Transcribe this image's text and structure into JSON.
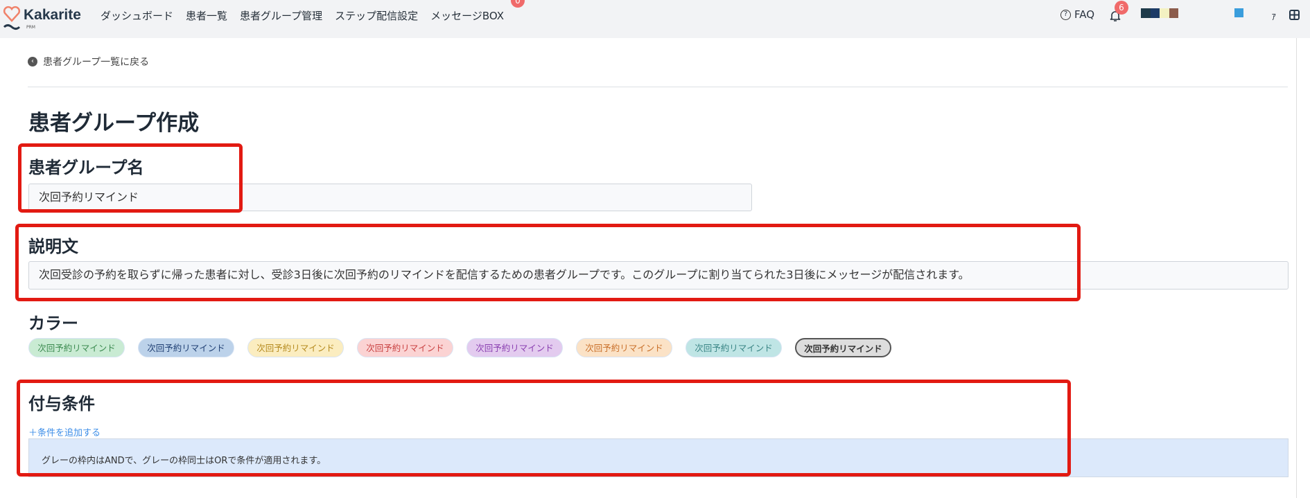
{
  "header": {
    "logo": "Kakarite",
    "logo_sub": "PRM",
    "nav": [
      "ダッシュボード",
      "患者一覧",
      "患者グループ管理",
      "ステップ配信設定",
      "メッセージBOX"
    ],
    "message_badge": "0",
    "faq": "FAQ",
    "notification_badge": "6",
    "user_initial": "ｧ"
  },
  "back_link": "患者グループ一覧に戻る",
  "page_title": "患者グループ作成",
  "name_section": {
    "label": "患者グループ名",
    "value": "次回予約リマインド"
  },
  "description_section": {
    "label": "説明文",
    "value": "次回受診の予約を取らずに帰った患者に対し、受診3日後に次回予約のリマインドを配信するための患者グループです。このグループに割り当てられた3日後にメッセージが配信されます。"
  },
  "color_section": {
    "label": "カラー",
    "options": [
      {
        "label": "次回予約リマインド",
        "bg": "#c9ebd3",
        "fg": "#3b8a4f"
      },
      {
        "label": "次回予約リマインド",
        "bg": "#bcd2ea",
        "fg": "#1f3f73"
      },
      {
        "label": "次回予約リマインド",
        "bg": "#fbedc0",
        "fg": "#b58a1e"
      },
      {
        "label": "次回予約リマインド",
        "bg": "#fbd3d3",
        "fg": "#c94242"
      },
      {
        "label": "次回予約リマインド",
        "bg": "#e3cbef",
        "fg": "#8a3fb0"
      },
      {
        "label": "次回予約リマインド",
        "bg": "#fbe2c6",
        "fg": "#c9702a"
      },
      {
        "label": "次回予約リマインド",
        "bg": "#bfe5e5",
        "fg": "#3a8585"
      },
      {
        "label": "次回予約リマインド",
        "bg": "#dddddd",
        "fg": "#333333",
        "selected": true
      }
    ]
  },
  "condition_section": {
    "label": "付与条件",
    "add_link": "条件を追加する",
    "info": "グレーの枠内はANDで、グレーの枠同士はORで条件が適用されます。"
  }
}
